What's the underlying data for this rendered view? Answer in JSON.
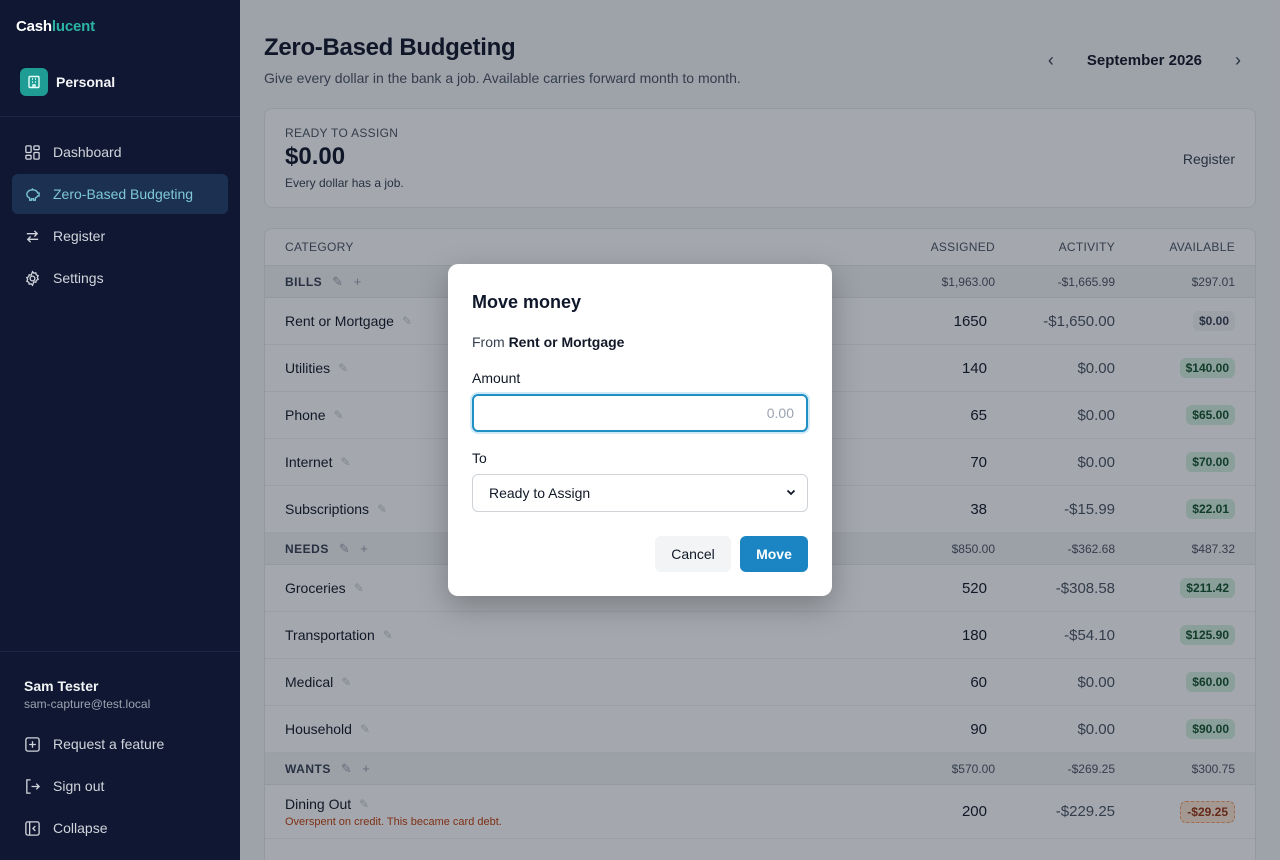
{
  "app": {
    "brand_part1": "Cash",
    "brand_part2": "lucent",
    "workspace": "Personal"
  },
  "sidebar": {
    "items": [
      {
        "label": "Dashboard",
        "icon": "dashboard-icon"
      },
      {
        "label": "Zero-Based Budgeting",
        "icon": "piggy-bank-icon",
        "active": true
      },
      {
        "label": "Register",
        "icon": "arrows-exchange-icon"
      },
      {
        "label": "Settings",
        "icon": "gear-icon"
      }
    ],
    "user": {
      "name": "Sam Tester",
      "email": "sam-capture@test.local"
    },
    "bottom": [
      {
        "label": "Request a feature",
        "icon": "plus-square-icon"
      },
      {
        "label": "Sign out",
        "icon": "sign-out-icon"
      },
      {
        "label": "Collapse",
        "icon": "collapse-icon"
      }
    ]
  },
  "header": {
    "title": "Zero-Based Budgeting",
    "subtitle": "Give every dollar in the bank a job. Available carries forward month to month.",
    "month": "September 2026"
  },
  "ready_to_assign": {
    "label": "READY TO ASSIGN",
    "amount": "$0.00",
    "note": "Every dollar has a job.",
    "register_link": "Register"
  },
  "table": {
    "headers": {
      "category": "CATEGORY",
      "assigned": "ASSIGNED",
      "activity": "ACTIVITY",
      "available": "AVAILABLE"
    },
    "groups": [
      {
        "name": "BILLS",
        "assigned": "$1,963.00",
        "activity": "-$1,665.99",
        "available": "$297.01",
        "rows": [
          {
            "name": "Rent or Mortgage",
            "assigned": "1650",
            "activity": "-$1,650.00",
            "available": "$0.00",
            "status": "gray"
          },
          {
            "name": "Utilities",
            "assigned": "140",
            "activity": "$0.00",
            "available": "$140.00",
            "status": "green"
          },
          {
            "name": "Phone",
            "assigned": "65",
            "activity": "$0.00",
            "available": "$65.00",
            "status": "green"
          },
          {
            "name": "Internet",
            "assigned": "70",
            "activity": "$0.00",
            "available": "$70.00",
            "status": "green"
          },
          {
            "name": "Subscriptions",
            "assigned": "38",
            "activity": "-$15.99",
            "available": "$22.01",
            "status": "green"
          }
        ]
      },
      {
        "name": "NEEDS",
        "assigned": "$850.00",
        "activity": "-$362.68",
        "available": "$487.32",
        "rows": [
          {
            "name": "Groceries",
            "assigned": "520",
            "activity": "-$308.58",
            "available": "$211.42",
            "status": "green"
          },
          {
            "name": "Transportation",
            "assigned": "180",
            "activity": "-$54.10",
            "available": "$125.90",
            "status": "green"
          },
          {
            "name": "Medical",
            "assigned": "60",
            "activity": "$0.00",
            "available": "$60.00",
            "status": "green"
          },
          {
            "name": "Household",
            "assigned": "90",
            "activity": "$0.00",
            "available": "$90.00",
            "status": "green"
          }
        ]
      },
      {
        "name": "WANTS",
        "assigned": "$570.00",
        "activity": "-$269.25",
        "available": "$300.75",
        "rows": [
          {
            "name": "Dining Out",
            "assigned": "200",
            "activity": "-$229.25",
            "available": "-$29.25",
            "status": "orange",
            "warning": "Overspent on credit. This became card debt."
          }
        ]
      }
    ]
  },
  "modal": {
    "title": "Move money",
    "from_prefix": "From",
    "from_category": "Rent or Mortgage",
    "amount_label": "Amount",
    "amount_value": "",
    "amount_placeholder": "0.00",
    "to_label": "To",
    "to_selected": "Ready to Assign",
    "cancel_label": "Cancel",
    "move_label": "Move"
  },
  "colors": {
    "sidebar_bg": "#0f1733",
    "accent": "#1a85c2",
    "brand_teal": "#2bb3a3",
    "available_green": "#d5f0e0",
    "overspent_orange": "#fde8d4"
  }
}
